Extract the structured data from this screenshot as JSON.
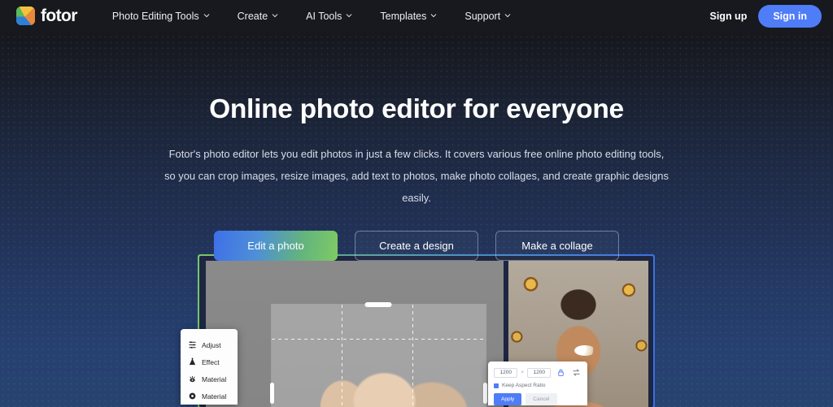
{
  "nav": {
    "logo_text": "fotor",
    "items": [
      {
        "label": "Photo Editing Tools",
        "has_caret": true
      },
      {
        "label": "Create",
        "has_caret": true
      },
      {
        "label": "AI Tools",
        "has_caret": true
      },
      {
        "label": "Templates",
        "has_caret": true
      },
      {
        "label": "Support",
        "has_caret": true
      }
    ],
    "signup_label": "Sign up",
    "signin_label": "Sign in",
    "signin_color": "#4f7cf7"
  },
  "hero": {
    "headline": "Online photo editor for everyone",
    "subtitle": "Fotor's photo editor lets you edit photos in just a few clicks. It covers various free online photo editing tools, so you can crop images, resize images, add text to photos, make photo collages, and create graphic designs easily.",
    "buttons": [
      {
        "label": "Edit a photo",
        "style": "gradient"
      },
      {
        "label": "Create a design",
        "style": "outline"
      },
      {
        "label": "Make a collage",
        "style": "outline"
      }
    ],
    "gradient_from": "#3f6fe8",
    "gradient_to": "#7ecb63"
  },
  "editor_mock": {
    "tool_panel": {
      "items": [
        {
          "label": "Adjust",
          "icon": "sliders-icon"
        },
        {
          "label": "Effect",
          "icon": "effect-icon"
        },
        {
          "label": "Material",
          "icon": "material-eye-icon"
        },
        {
          "label": "Material",
          "icon": "material-dot-icon"
        }
      ]
    },
    "resize_panel": {
      "width_value": "1200",
      "height_value": "1200",
      "separator": "×",
      "lock_icon": "lock-icon",
      "swap_icon": "swap-icon",
      "keep_aspect_label": "Keep Aspect Ratio",
      "apply_label": "Apply",
      "cancel_label": "Cancel",
      "apply_color": "#4f7cf7"
    }
  },
  "theme": {
    "bg_top": "#16181d",
    "bg_bottom": "#27436f",
    "text": "#ffffff",
    "muted_text": "#d9dde8"
  }
}
